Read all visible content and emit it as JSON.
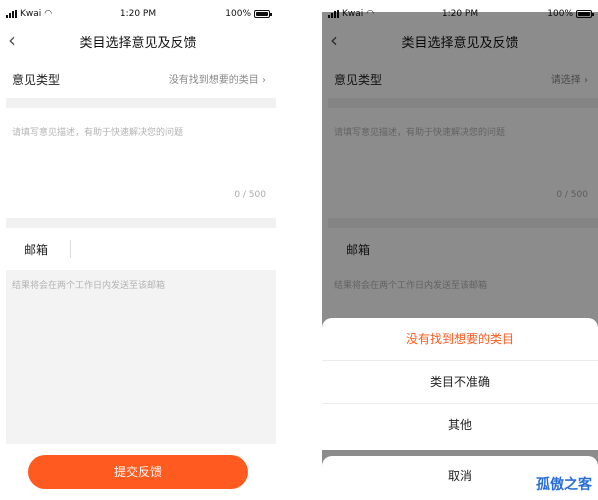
{
  "status_bar": {
    "carrier": "Kwai",
    "time": "1:20 PM",
    "battery": "100%"
  },
  "nav": {
    "title": "类目选择意见及反馈"
  },
  "form": {
    "type_label": "意见类型",
    "type_value_left": "没有找到想要的类目",
    "type_value_right": "请选择",
    "desc_placeholder": "请填写意见描述，有助于快速解决您的问题",
    "counter": "0 / 500",
    "email_label": "邮箱",
    "email_placeholder": "结果将会在两个工作日内发送至该邮箱"
  },
  "submit_label": "提交反馈",
  "action_sheet": {
    "options": [
      "没有找到想要的类目",
      "类目不准确",
      "其他"
    ],
    "cancel": "取消"
  },
  "watermark": "孤傲之客",
  "colors": {
    "accent": "#ff5a1f"
  }
}
